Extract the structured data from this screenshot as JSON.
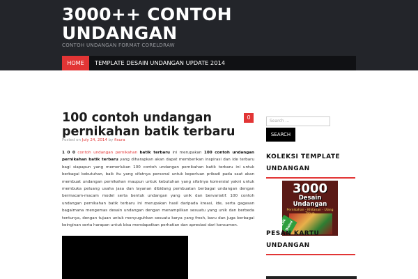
{
  "header": {
    "title": "3000++ CONTOH UNDANGAN",
    "description": "CONTOH UNDANGAN FORMAT CORELDRAW"
  },
  "nav": {
    "items": [
      {
        "label": "Home"
      },
      {
        "label": "Template Desain Undangan Update 2014"
      }
    ]
  },
  "post": {
    "title": "100 contoh undangan pernikahan batik terbaru",
    "comment_count": "0",
    "meta": {
      "prefix": "Posted on",
      "date": "July 24, 2014",
      "by": "by",
      "author": "fisura"
    },
    "content": {
      "lead_number": "1 0 0",
      "link_text": "contoh undangan pernikahan",
      "bold1": "batik terbaru",
      "t1": " ini merupakan ",
      "bold2": "100 contoh undangan pernikahan batik terbaru",
      "t2": " yang diharapkan akan dapat  memberikan inspirasi dan ide terbaru bagi siapapun yang memerlukan 100 contoh undangan pernikahan batik terbaru ini untuk berbagai kebutuhan, baik itu yang sifatnya personal untuk keperluan pribadi pada saat akan membuat undangan pernikahan maupun untuk kebutuhan yang sifatnya komersial yakni untuk membuka peluang usaha jasa dan layanan dibidang pembuatan berbagai undangan dengan bermacam-macam model serta bentuk undangan yang unik dan bervariatif. 100 contoh undangan pernikahan batik terbaru ini merupakan hasil daripada kreasi, ide, serta gagasan bagaimana mengemas desain undangan dengan menampilkan sesuatu yang unik dan berbeda tentunya, dengan tujuan untuk menyuguhkan sesuatu karya yang fresh, baru dan juga berbagai keinginan serta harapan untuk bisa mendapatkan perhatian dan apresiasi dari konsumen."
    }
  },
  "sidebar": {
    "search": {
      "placeholder": "Search …",
      "button_label": "Search"
    },
    "widgets": [
      {
        "title": "KOLEKSI TEMPLATE UNDANGAN"
      },
      {
        "title": "PESAN KARTU UNDANGAN"
      }
    ],
    "ad": {
      "number": "3000",
      "text": "Desain Undangan",
      "sub": "Pernikahan - Khitanan - Ulang Tahun",
      "badge": "Klik Disini"
    }
  },
  "colors": {
    "accent": "#e23535",
    "header_bg": "#23252a",
    "nav_bg": "#101114"
  }
}
